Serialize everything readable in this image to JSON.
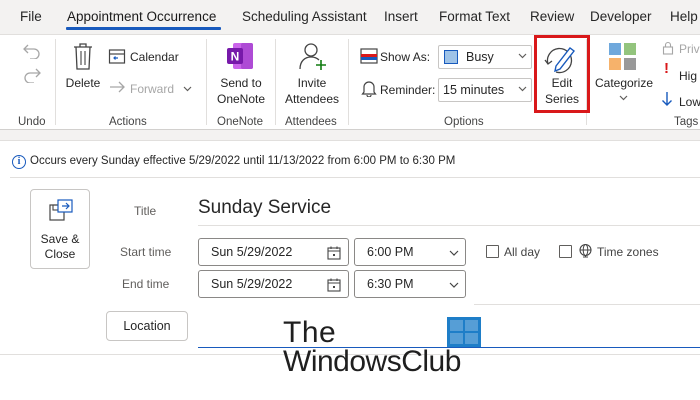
{
  "tabs": [
    {
      "label": "File"
    },
    {
      "label": "Appointment Occurrence"
    },
    {
      "label": "Scheduling Assistant"
    },
    {
      "label": "Insert"
    },
    {
      "label": "Format Text"
    },
    {
      "label": "Review"
    },
    {
      "label": "Developer"
    },
    {
      "label": "Help"
    }
  ],
  "ribbon": {
    "undo_group": "Undo",
    "actions": {
      "delete": "Delete",
      "calendar": "Calendar",
      "forward": "Forward",
      "group": "Actions"
    },
    "onenote": {
      "line1": "Send to",
      "line2": "OneNote",
      "group": "OneNote"
    },
    "attendees": {
      "line1": "Invite",
      "line2": "Attendees",
      "group": "Attendees"
    },
    "options": {
      "show_as_label": "Show As:",
      "show_as_value": "Busy",
      "reminder_label": "Reminder:",
      "reminder_value": "15 minutes",
      "group": "Options"
    },
    "edit_series": {
      "line1": "Edit",
      "line2": "Series"
    },
    "tags": {
      "categorize": "Categorize",
      "private": "Priv",
      "high": "Hig",
      "low": "Low",
      "group": "Tags"
    }
  },
  "recurrence_info": "Occurs every Sunday effective 5/29/2022 until 11/13/2022 from 6:00 PM to 6:30 PM",
  "form": {
    "save_close_line1": "Save &",
    "save_close_line2": "Close",
    "title_label": "Title",
    "title_value": "Sunday Service",
    "start_label": "Start time",
    "start_date": "Sun 5/29/2022",
    "start_time": "6:00 PM",
    "end_label": "End time",
    "end_date": "Sun 5/29/2022",
    "end_time": "6:30 PM",
    "all_day": "All day",
    "time_zones": "Time zones",
    "location": "Location"
  },
  "watermark": {
    "line1": "The",
    "line2": "WindowsClub"
  },
  "colors": {
    "accent": "#185abd",
    "highlight": "#d9181a"
  }
}
